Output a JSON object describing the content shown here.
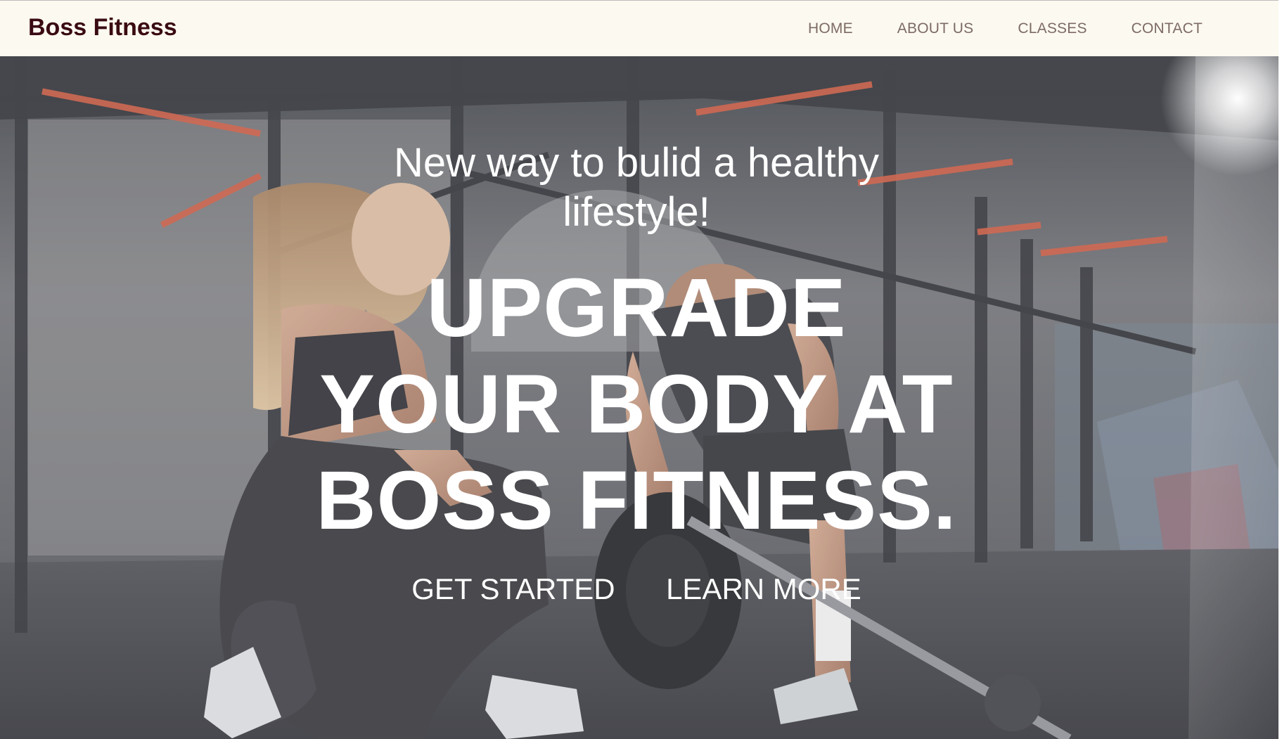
{
  "header": {
    "brand": "Boss Fitness",
    "nav": [
      "HOME",
      "ABOUT US",
      "CLASSES",
      "CONTACT"
    ]
  },
  "hero": {
    "tagline_line1": "New way to bulid a healthy",
    "tagline_line2": "lifestyle!",
    "headline_lines": [
      "UPGRADE",
      "YOUR BODY AT",
      "BOSS FITNESS."
    ],
    "cta_primary": "GET STARTED",
    "cta_secondary": "LEARN MORE"
  },
  "colors": {
    "header_bg": "#fcf9f0",
    "brand_text": "#3a0b12",
    "nav_text": "#7d6b65",
    "hero_text": "#ffffff",
    "rack_accent": "#c9553c"
  },
  "background_image": "gym-photo-woman-kneeling-man-deadlifting-barbell"
}
